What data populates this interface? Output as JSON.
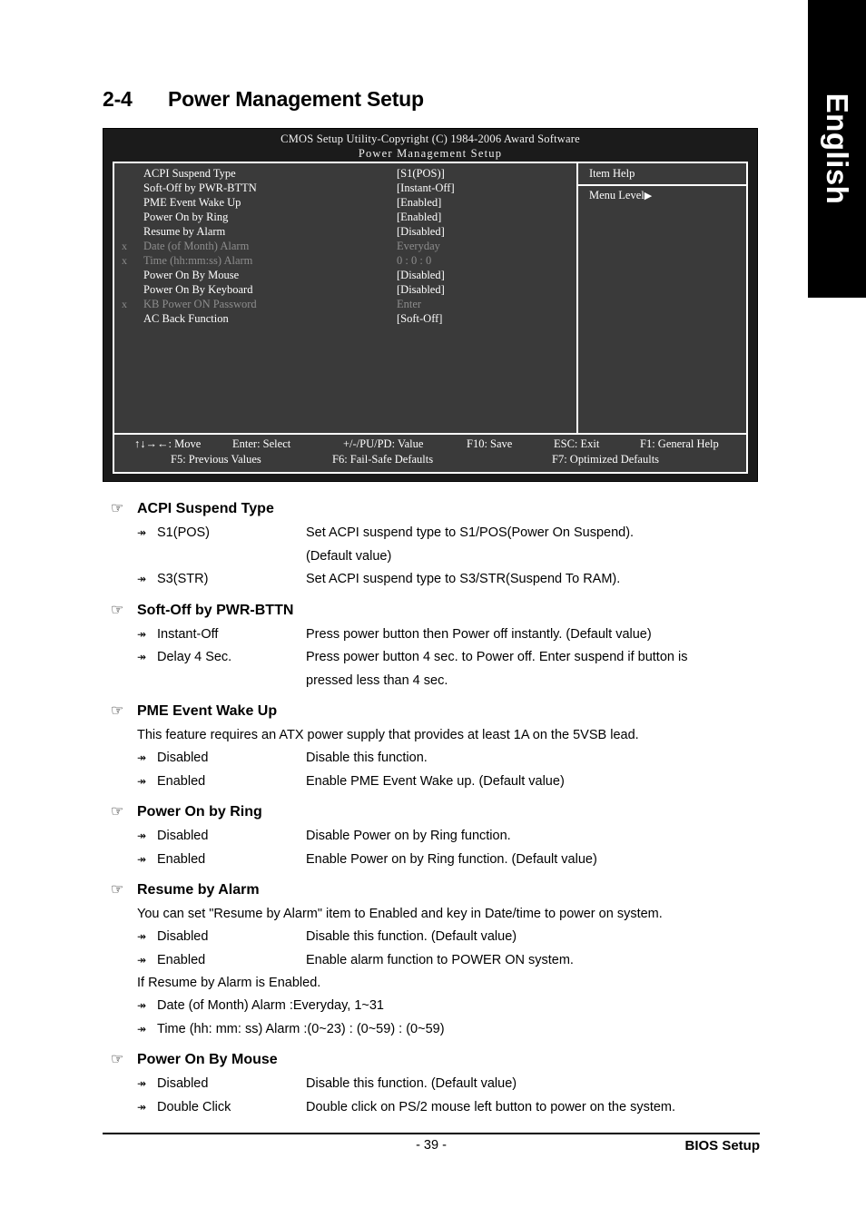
{
  "language_tab": {
    "label": "English"
  },
  "page_title": {
    "number": "2-4",
    "text": "Power Management Setup"
  },
  "bios": {
    "header_line1": "CMOS Setup Utility-Copyright (C) 1984-2006 Award Software",
    "header_line2": "Power Management Setup",
    "item_help_title": "Item Help",
    "menu_level": "Menu Level",
    "menu_level_caret": "▶",
    "items": [
      {
        "x": "",
        "label": "ACPI Suspend Type",
        "value": "[S1(POS)]",
        "disabled": false
      },
      {
        "x": "",
        "label": "Soft-Off by PWR-BTTN",
        "value": "[Instant-Off]",
        "disabled": false
      },
      {
        "x": "",
        "label": "PME Event Wake Up",
        "value": "[Enabled]",
        "disabled": false
      },
      {
        "x": "",
        "label": "Power On by Ring",
        "value": "[Enabled]",
        "disabled": false
      },
      {
        "x": "",
        "label": "Resume by Alarm",
        "value": "[Disabled]",
        "disabled": false
      },
      {
        "x": "x",
        "label": "Date (of Month) Alarm",
        "value": "Everyday",
        "disabled": true
      },
      {
        "x": "x",
        "label": "Time (hh:mm:ss) Alarm",
        "value": "0 : 0 : 0",
        "disabled": true
      },
      {
        "x": "",
        "label": "Power On By Mouse",
        "value": "[Disabled]",
        "disabled": false
      },
      {
        "x": "",
        "label": "Power On By Keyboard",
        "value": "[Disabled]",
        "disabled": false
      },
      {
        "x": "x",
        "label": "KB Power ON Password",
        "value": "Enter",
        "disabled": true
      },
      {
        "x": "",
        "label": "AC Back Function",
        "value": "[Soft-Off]",
        "disabled": false
      }
    ],
    "footer_row1": {
      "move": "↑↓→←: Move",
      "select": "Enter: Select",
      "value": "+/-/PU/PD: Value",
      "save": "F10: Save",
      "exit": "ESC: Exit",
      "help": "F1: General Help"
    },
    "footer_row2": {
      "previous": "F5: Previous Values",
      "failsafe": "F6: Fail-Safe Defaults",
      "optimized": "F7: Optimized Defaults"
    }
  },
  "icons": {
    "hand": "☞",
    "arrow": "↠"
  },
  "sections": [
    {
      "heading": "ACPI Suspend Type",
      "note": "",
      "options": [
        {
          "label": "S1(POS)",
          "desc": "Set ACPI suspend type to S1/POS(Power On Suspend).",
          "desc2": "(Default value)"
        },
        {
          "label": "S3(STR)",
          "desc": "Set ACPI suspend type to S3/STR(Suspend To RAM).",
          "desc2": ""
        }
      ],
      "note_after": ""
    },
    {
      "heading": "Soft-Off by PWR-BTTN",
      "note": "",
      "options": [
        {
          "label": "Instant-Off",
          "desc": "Press power button then Power off instantly. (Default value)",
          "desc2": ""
        },
        {
          "label": "Delay 4 Sec.",
          "desc": "Press power button 4 sec. to Power off. Enter suspend if button is",
          "desc2": "pressed less than 4 sec."
        }
      ],
      "note_after": ""
    },
    {
      "heading": "PME Event Wake Up",
      "note": "This feature requires an ATX power supply that provides at least 1A on the 5VSB lead.",
      "options": [
        {
          "label": "Disabled",
          "desc": "Disable this function.",
          "desc2": ""
        },
        {
          "label": "Enabled",
          "desc": "Enable PME Event Wake up. (Default value)",
          "desc2": ""
        }
      ],
      "note_after": ""
    },
    {
      "heading": "Power On by Ring",
      "note": "",
      "options": [
        {
          "label": "Disabled",
          "desc": "Disable Power on by Ring function.",
          "desc2": ""
        },
        {
          "label": "Enabled",
          "desc": "Enable Power on by Ring function. (Default value)",
          "desc2": ""
        }
      ],
      "note_after": ""
    },
    {
      "heading": "Resume by Alarm",
      "note": "You can set \"Resume by Alarm\" item to Enabled and key in Date/time to power on system.",
      "options": [
        {
          "label": "Disabled",
          "desc": "Disable this function. (Default value)",
          "desc2": ""
        },
        {
          "label": "Enabled",
          "desc": "Enable alarm function to POWER ON system.",
          "desc2": ""
        }
      ],
      "note_after": "If Resume by Alarm is Enabled.",
      "options_after": [
        {
          "label": "Date (of Month) Alarm :",
          "desc": "Everyday, 1~31",
          "desc2": ""
        },
        {
          "label": "Time (hh: mm: ss) Alarm :",
          "desc": "(0~23) : (0~59) : (0~59)",
          "desc2": ""
        }
      ]
    },
    {
      "heading": "Power On By Mouse",
      "note": "",
      "options": [
        {
          "label": "Disabled",
          "desc": "Disable this function. (Default value)",
          "desc2": ""
        },
        {
          "label": "Double Click",
          "desc": "Double click on PS/2 mouse left button to power on the system.",
          "desc2": ""
        }
      ],
      "note_after": ""
    }
  ],
  "footer": {
    "page_number": "- 39 -",
    "doc_title": "BIOS Setup"
  }
}
